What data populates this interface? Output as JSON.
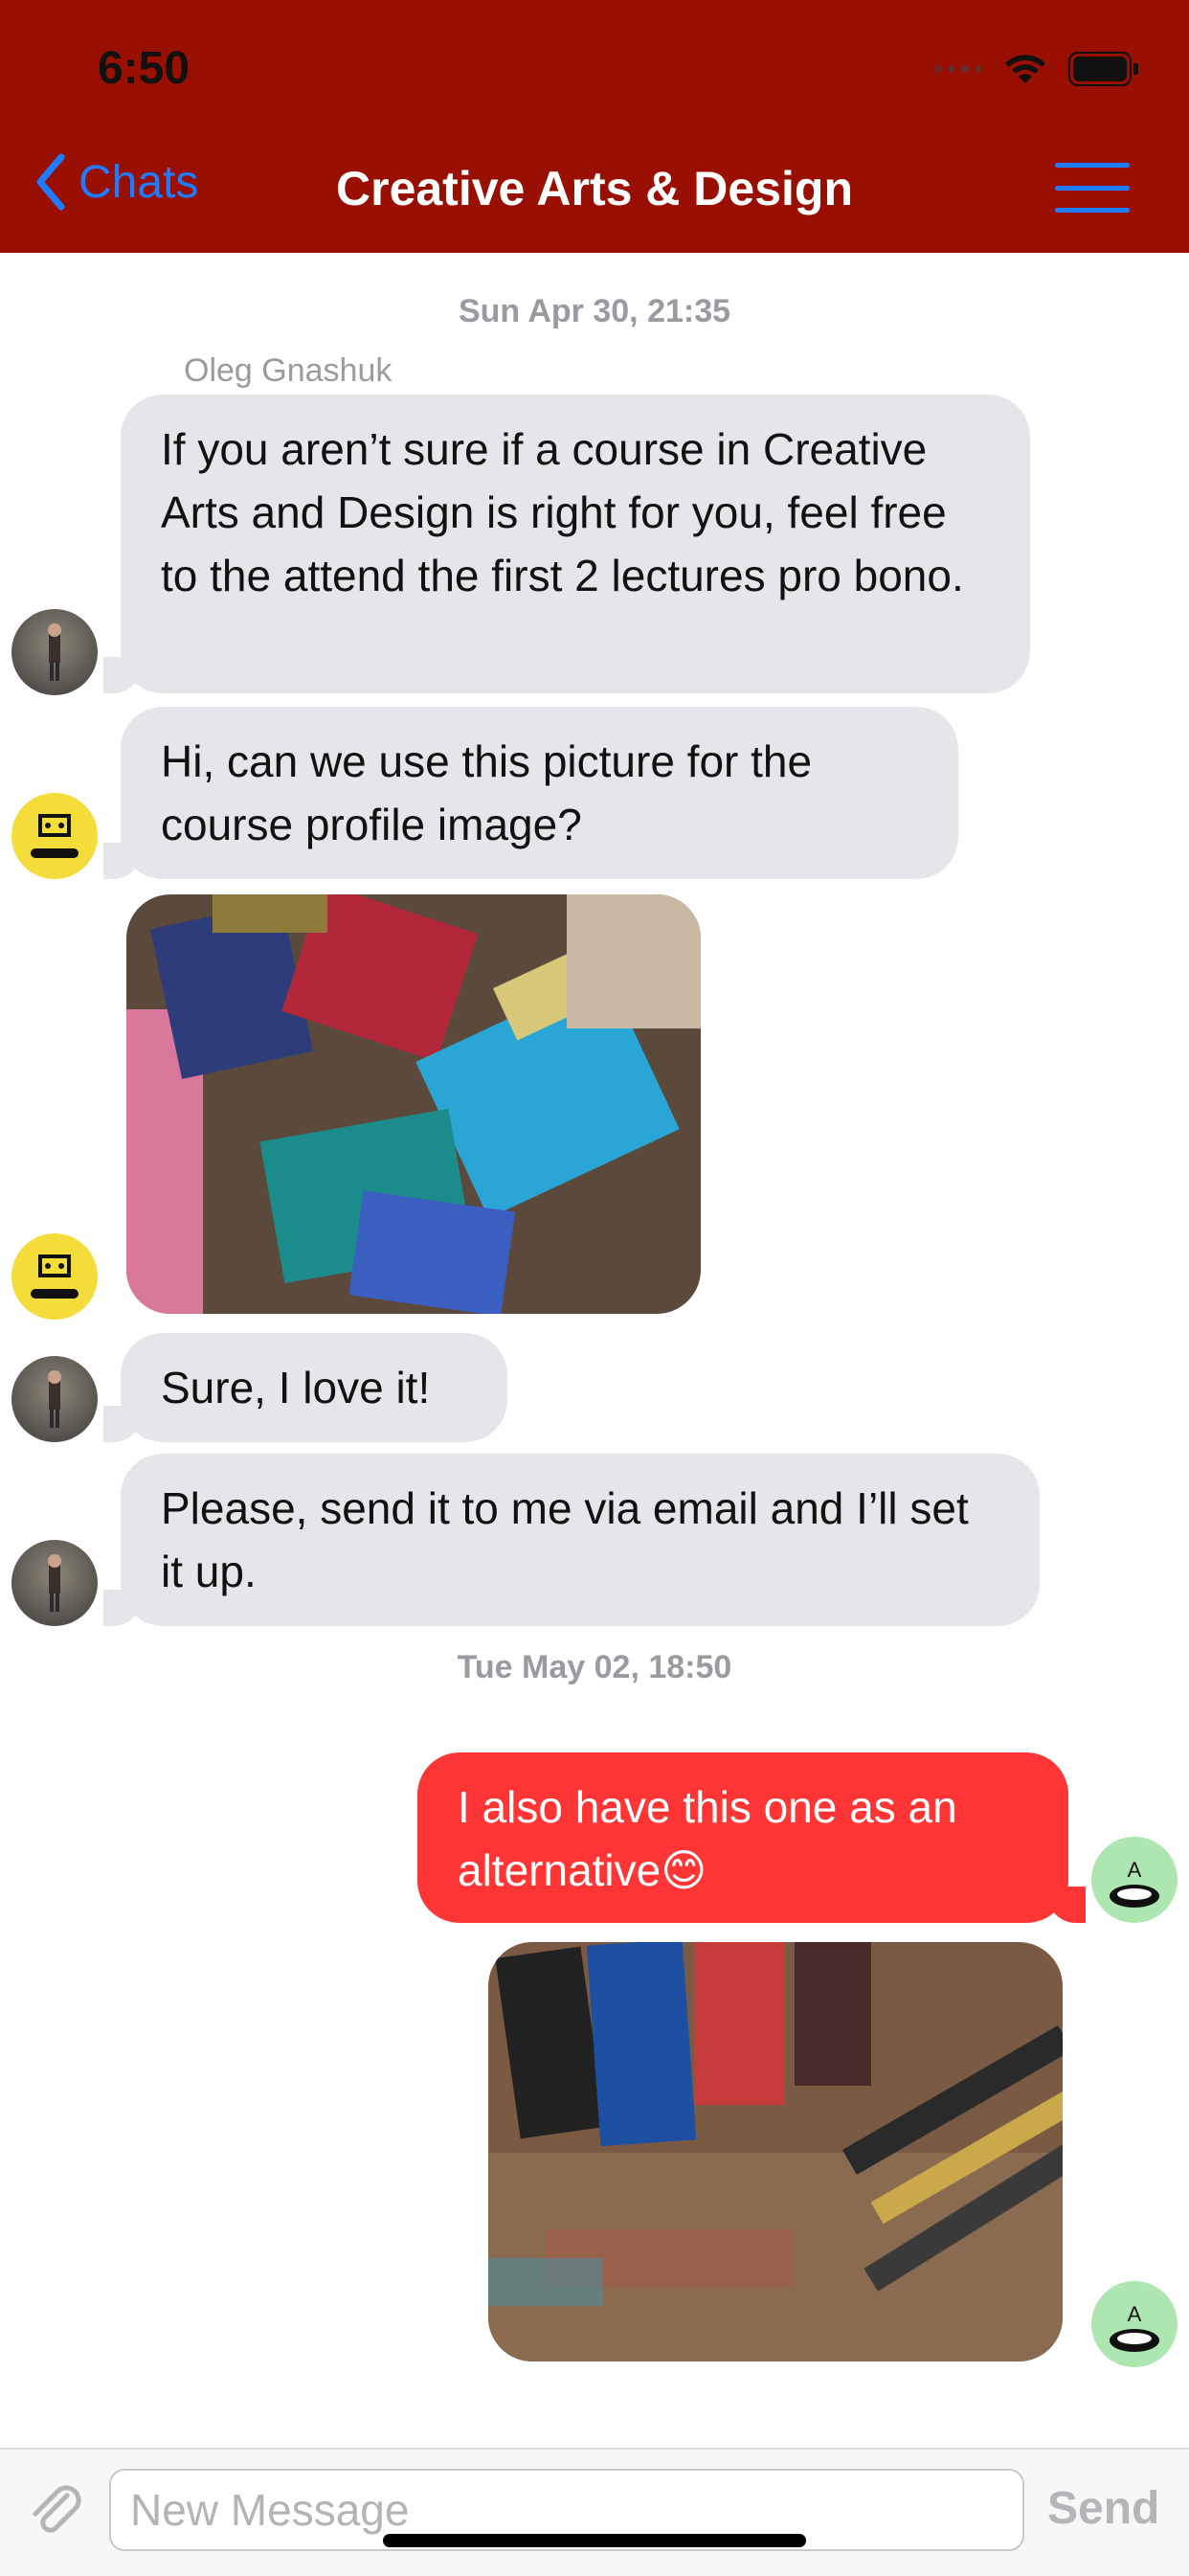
{
  "status_bar": {
    "time": "6:50"
  },
  "nav": {
    "back_label": "Chats",
    "title": "Creative Arts & Design"
  },
  "dates": {
    "first": "Sun Apr 30, 21:35",
    "second": "Tue May 02, 18:50"
  },
  "sender_name": "Oleg  Gnashuk",
  "messages": [
    {
      "text": "If you aren’t sure if a course in Creative Arts and Design is right for you, feel free to the attend the first 2 lectures pro bono."
    },
    {
      "text": "Hi, can we use this picture for the course profile image?"
    },
    {
      "text": "Sure, I love it!"
    },
    {
      "text": "Please, send it to me via email and I’ll set it up."
    },
    {
      "text": "I also have this one as an alternative😊"
    }
  ],
  "composer": {
    "placeholder": "New Message",
    "send_label": "Send"
  },
  "colors": {
    "header": "#991002",
    "accent": "#1f7cff",
    "outgoing": "#ff3535",
    "incoming": "#e6e6ea"
  },
  "icons": [
    "chevron-left-icon",
    "hamburger-menu-icon",
    "wifi-icon",
    "battery-icon",
    "paperclip-icon"
  ]
}
